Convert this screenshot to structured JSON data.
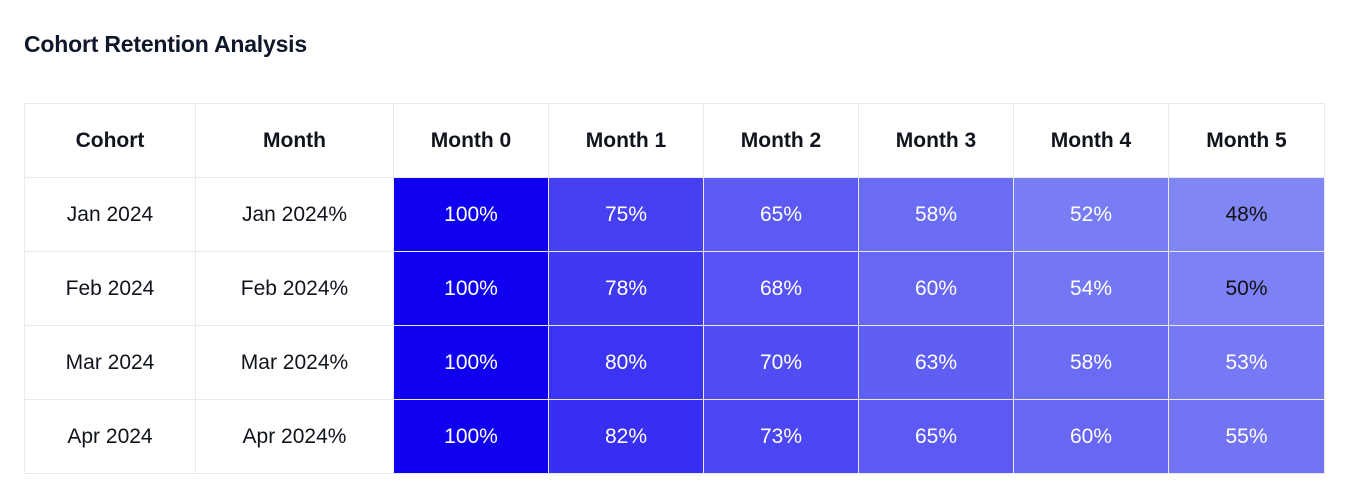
{
  "title": "Cohort Retention Analysis",
  "table": {
    "columns": [
      "Cohort",
      "Month",
      "Month 0",
      "Month 1",
      "Month 2",
      "Month 3",
      "Month 4",
      "Month 5"
    ],
    "rows": [
      {
        "cohort": "Jan 2024",
        "month": "Jan 2024%",
        "cells": [
          "100%",
          "75%",
          "65%",
          "58%",
          "52%",
          "48%"
        ]
      },
      {
        "cohort": "Feb 2024",
        "month": "Feb 2024%",
        "cells": [
          "100%",
          "78%",
          "68%",
          "60%",
          "54%",
          "50%"
        ]
      },
      {
        "cohort": "Mar 2024",
        "month": "Mar 2024%",
        "cells": [
          "100%",
          "80%",
          "70%",
          "63%",
          "58%",
          "53%"
        ]
      },
      {
        "cohort": "Apr 2024",
        "month": "Apr 2024%",
        "cells": [
          "100%",
          "82%",
          "73%",
          "65%",
          "60%",
          "55%"
        ]
      }
    ]
  },
  "colors": {
    "heat_high": "#1000f0",
    "heat_low": "#8186f5",
    "border": "#e8eaed",
    "text_dark": "#10141c",
    "text_light": "#ffffff",
    "background": "#ffffff"
  },
  "chart_data": {
    "type": "heatmap",
    "title": "Cohort Retention Analysis",
    "xlabel": "",
    "ylabel": "",
    "x_categories": [
      "Month 0",
      "Month 1",
      "Month 2",
      "Month 3",
      "Month 4",
      "Month 5"
    ],
    "y_categories": [
      "Jan 2024",
      "Feb 2024",
      "Mar 2024",
      "Apr 2024"
    ],
    "values": [
      [
        100,
        75,
        65,
        58,
        52,
        48
      ],
      [
        100,
        78,
        68,
        60,
        54,
        50
      ],
      [
        100,
        80,
        70,
        63,
        58,
        53
      ],
      [
        100,
        82,
        73,
        65,
        60,
        55
      ]
    ],
    "unit": "%",
    "value_range": [
      48,
      100
    ],
    "colorscale": {
      "low": "#8186f5",
      "high": "#1000f0"
    },
    "legend": "none",
    "grid": true
  }
}
